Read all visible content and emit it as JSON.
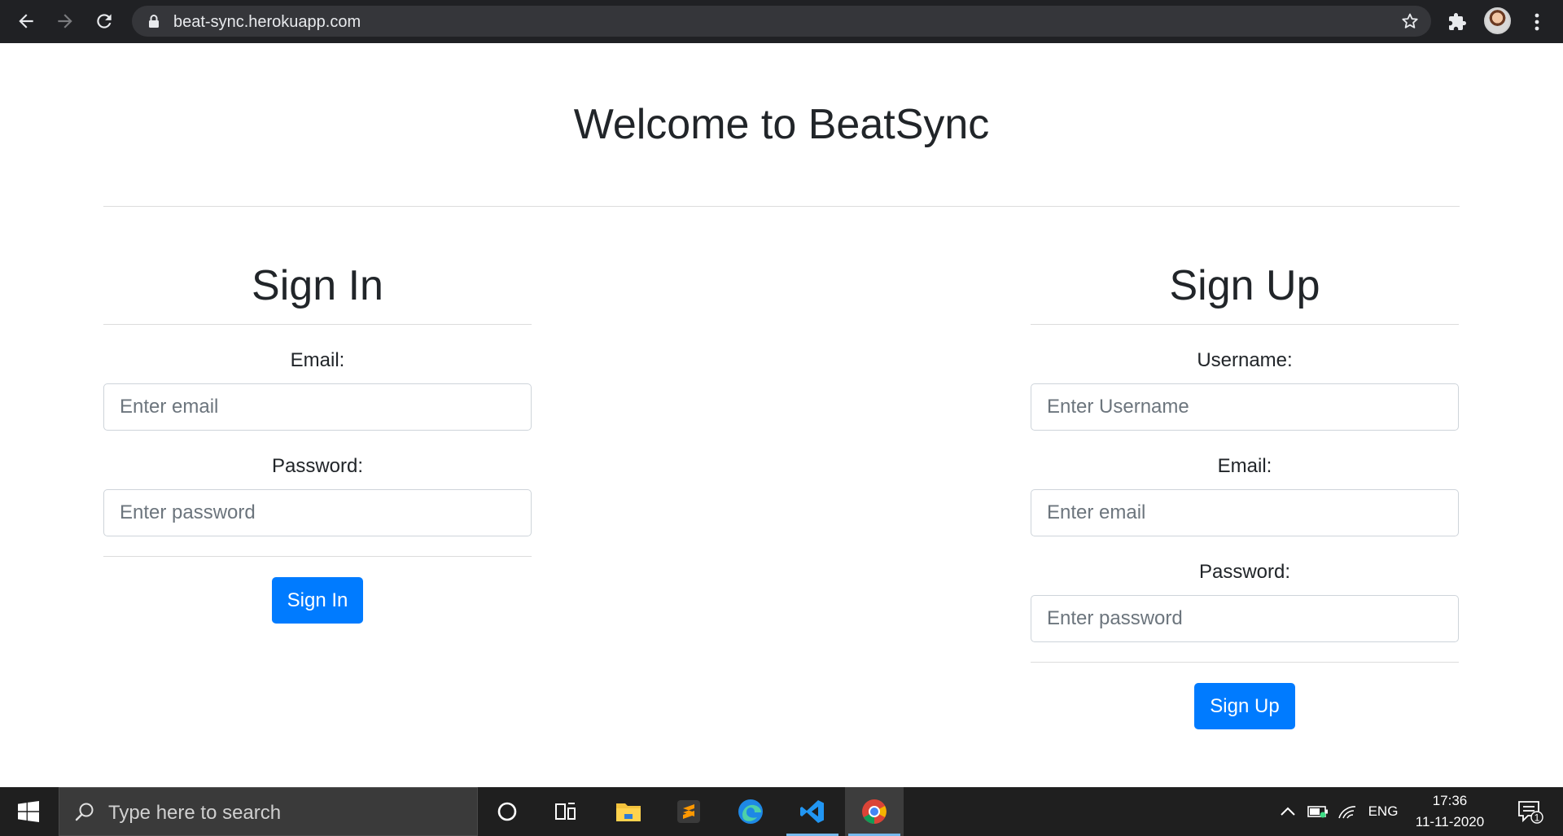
{
  "browser": {
    "url": "beat-sync.herokuapp.com"
  },
  "page": {
    "welcome": "Welcome to BeatSync",
    "sign_in": {
      "title": "Sign In",
      "email_label": "Email:",
      "email_placeholder": "Enter email",
      "password_label": "Password:",
      "password_placeholder": "Enter password",
      "button": "Sign In"
    },
    "sign_up": {
      "title": "Sign Up",
      "username_label": "Username:",
      "username_placeholder": "Enter Username",
      "email_label": "Email:",
      "email_placeholder": "Enter email",
      "password_label": "Password:",
      "password_placeholder": "Enter password",
      "button": "Sign Up"
    }
  },
  "taskbar": {
    "search_placeholder": "Type here to search",
    "pinned": [
      "cortana-icon",
      "task-view-icon",
      "file-explorer-icon",
      "sublime-text-icon",
      "edge-icon",
      "vscode-icon",
      "chrome-icon"
    ],
    "language": "ENG",
    "time": "17:36",
    "date": "11-11-2020",
    "notification_count": "1"
  },
  "colors": {
    "chrome_bg": "#202124",
    "omnibox_bg": "#35363a",
    "primary": "#007bff",
    "taskbar_bg": "#1f1f1f"
  }
}
